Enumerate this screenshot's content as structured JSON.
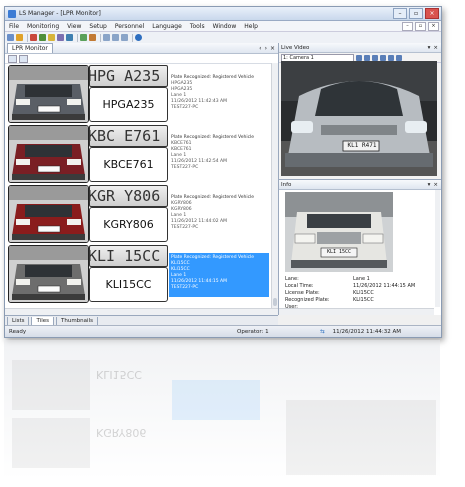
{
  "window": {
    "title": "LS Manager - [LPR Monitor]"
  },
  "menu": [
    "File",
    "Monitoring",
    "View",
    "Setup",
    "Personnel",
    "Language",
    "Tools",
    "Window",
    "Help"
  ],
  "left_pane": {
    "tab_label": "LPR Monitor"
  },
  "records": [
    {
      "crop_text": "HPG A235",
      "plate": "HPGA235",
      "status": "Plate Recognized: Registered Vehicle",
      "line1": "HPGA235",
      "line2": "HPGA235",
      "lane": "Lane 1",
      "time": "11/26/2012 11:42:43 AM",
      "station": "TEST227-PC",
      "selected": false,
      "car_color": "#5a5f66"
    },
    {
      "crop_text": "KBC E761",
      "plate": "KBCE761",
      "status": "Plate Recognized: Registered Vehicle",
      "line1": "KBCE761",
      "line2": "KBCE761",
      "lane": "Lane 1",
      "time": "11/26/2012 11:42:54 AM",
      "station": "TEST227-PC",
      "selected": false,
      "car_color": "#7a1f24"
    },
    {
      "crop_text": "KGR Y806",
      "plate": "KGRY806",
      "status": "Plate Recognized: Registered Vehicle",
      "line1": "KGRY806",
      "line2": "KGRY806",
      "lane": "Lane 1",
      "time": "11/26/2012 11:44:02 AM",
      "station": "TEST227-PC",
      "selected": false,
      "car_color": "#8a1c1c"
    },
    {
      "crop_text": "KLI 15CC",
      "plate": "KLI15CC",
      "status": "Plate Recognized: Registered Vehicle",
      "line1": "KLI15CC",
      "line2": "KLI15CC",
      "lane": "Lane 1",
      "time": "11/26/2012 11:44:15 AM",
      "station": "TEST227-PC",
      "selected": true,
      "car_color": "#6d6d6d"
    }
  ],
  "live_video": {
    "title": "Live Video",
    "camera": "1: Camera 1",
    "plate_overlay": "KL1 R471"
  },
  "info": {
    "title": "Info",
    "image_plate": "KLI 15CC",
    "fields": [
      {
        "label": "Lane:",
        "value": "Lane 1"
      },
      {
        "label": "Local Time:",
        "value": "11/26/2012 11:44:15 AM"
      },
      {
        "label": "License Plate:",
        "value": "KLI15CC"
      },
      {
        "label": "Recognized Plate:",
        "value": "KLI15CC"
      },
      {
        "label": "User:",
        "value": ""
      }
    ]
  },
  "bottom_tabs": [
    "Lists",
    "Tiles",
    "Thumbnails"
  ],
  "status": {
    "left": "Ready",
    "operator": "Operator: 1",
    "datetime": "11/26/2012 11:44:32 AM"
  }
}
